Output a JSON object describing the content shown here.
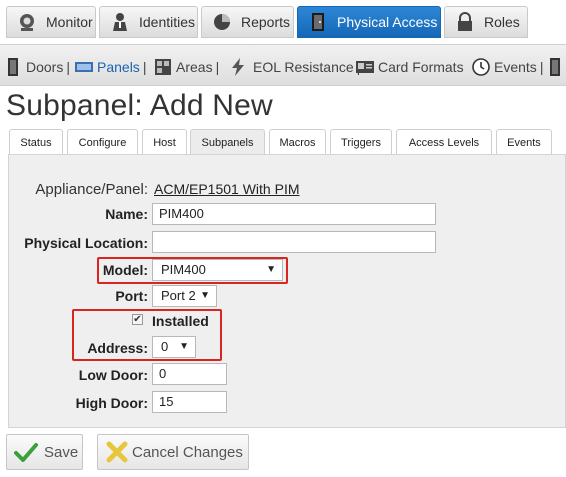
{
  "topnav": {
    "monitor": "Monitor",
    "identities": "Identities",
    "reports": "Reports",
    "physical_access": "Physical Access",
    "roles": "Roles"
  },
  "subnav": {
    "doors": "Doors",
    "panels": "Panels",
    "areas": "Areas",
    "eol_resistance": "EOL Resistance",
    "card_formats": "Card Formats",
    "events": "Events",
    "separator": "|"
  },
  "page": {
    "title": "Subpanel: Add New"
  },
  "tabs": [
    "Status",
    "Configure",
    "Host",
    "Subpanels",
    "Macros",
    "Triggers",
    "Access Levels",
    "Events"
  ],
  "form": {
    "appliance_label": "Appliance/Panel:",
    "appliance_value": "ACM/EP1501 With PIM",
    "name_label": "Name:",
    "name_value": "PIM400",
    "location_label": "Physical Location:",
    "location_value": "",
    "model_label": "Model:",
    "model_value": "PIM400",
    "port_label": "Port:",
    "port_value": "Port 2",
    "installed_label": "Installed",
    "installed_checked": true,
    "address_label": "Address:",
    "address_value": "0",
    "low_door_label": "Low Door:",
    "low_door_value": "0",
    "high_door_label": "High Door:",
    "high_door_value": "15"
  },
  "buttons": {
    "save": "Save",
    "cancel": "Cancel Changes"
  },
  "colors": {
    "accent": "#1b6fc2",
    "highlight": "#d9241f",
    "save_check": "#3aa13a",
    "cancel_x": "#e6c63a"
  }
}
